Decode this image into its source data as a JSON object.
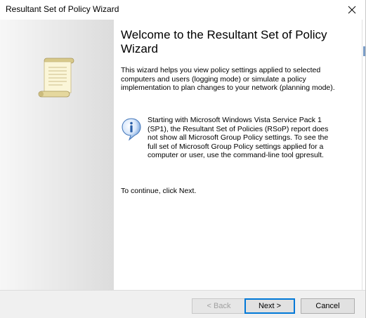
{
  "window": {
    "title": "Resultant Set of Policy Wizard"
  },
  "content": {
    "heading": "Welcome to the Resultant Set of Policy Wizard",
    "intro": "This wizard helps you view policy settings applied to selected computers and users (logging mode) or simulate a policy implementation to plan changes to your network (planning mode).",
    "info_note": "Starting with Microsoft Windows Vista Service Pack 1 (SP1), the Resultant Set of Policies (RSoP) report does not show all Microsoft Group Policy settings.  To see the full set of Microsoft Group Policy settings applied for a computer or user, use the command-line tool gpresult.",
    "continue_text": "To continue, click Next."
  },
  "buttons": {
    "back_label": "< Back",
    "next_label": "Next >",
    "cancel_label": "Cancel"
  },
  "icons": {
    "close": "close-icon",
    "scroll": "policy-scroll-icon",
    "info": "info-icon"
  },
  "colors": {
    "accent": "#0078d7",
    "info_blue": "#2a6fc9"
  }
}
